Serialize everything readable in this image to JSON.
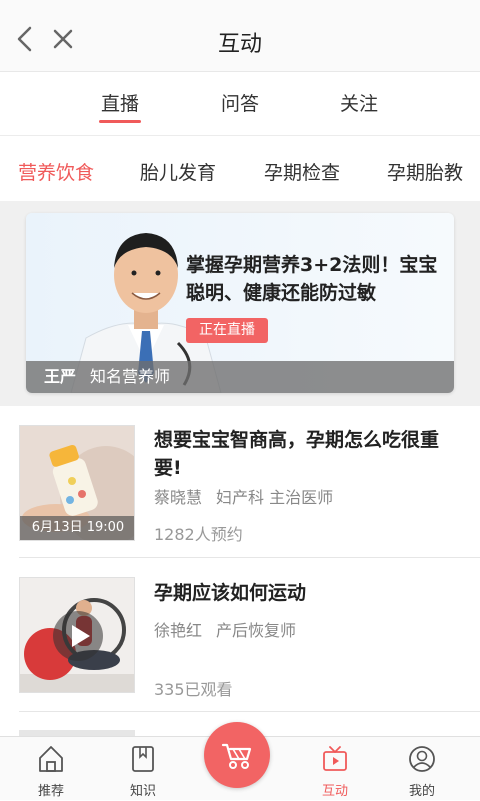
{
  "header": {
    "title": "互动"
  },
  "tabs": [
    {
      "label": "直播",
      "active": true
    },
    {
      "label": "问答",
      "active": false
    },
    {
      "label": "关注",
      "active": false
    }
  ],
  "categories": [
    {
      "label": "营养饮食",
      "active": true
    },
    {
      "label": "胎儿发育",
      "active": false
    },
    {
      "label": "孕期检查",
      "active": false
    },
    {
      "label": "孕期胎教",
      "active": false
    }
  ],
  "featured": {
    "title": "掌握孕期营养3+2法则！宝宝聪明、健康还能防过敏",
    "badge": "正在直播",
    "doctor_name": "王严",
    "doctor_title": "知名营养师"
  },
  "items": [
    {
      "title": "想要宝宝智商高，孕期怎么吃很重要!",
      "doctor_name": "蔡晓慧",
      "doctor_title": "妇产科 主治医师",
      "time": "6月13日 19:00",
      "stat": "1282人预约"
    },
    {
      "title": "孕期应该如何运动",
      "doctor_name": "徐艳红",
      "doctor_title": "产后恢复师",
      "stat": "335已观看"
    }
  ],
  "tabbar": [
    {
      "label": "推荐",
      "icon": "home-icon",
      "active": false
    },
    {
      "label": "知识",
      "icon": "book-icon",
      "active": false
    },
    {
      "label": "互动",
      "icon": "tv-icon",
      "active": true
    },
    {
      "label": "我的",
      "icon": "profile-icon",
      "active": false
    }
  ],
  "center_button": {
    "icon": "stroller-icon"
  },
  "colors": {
    "accent": "#f05a5a",
    "badge": "#f26464"
  }
}
